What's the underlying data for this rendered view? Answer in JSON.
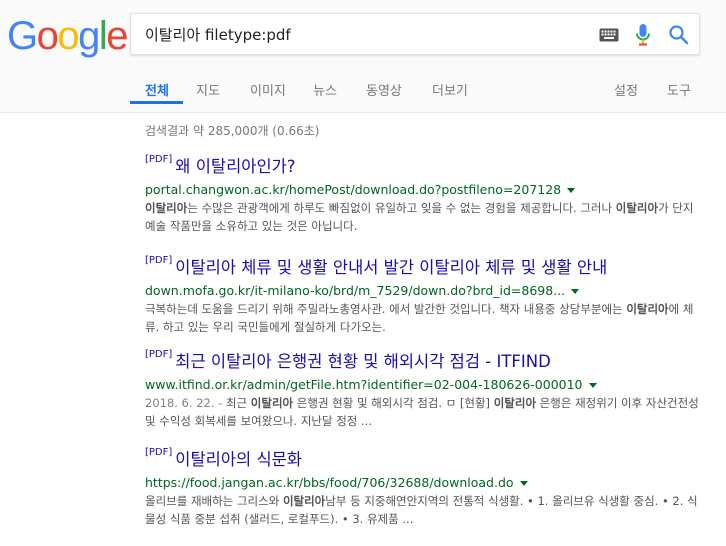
{
  "logo": {
    "text": "Google",
    "colors": [
      "#4285F4",
      "#EA4335",
      "#FBBC05",
      "#4285F4",
      "#34A853",
      "#EA4335"
    ]
  },
  "search": {
    "query": "이탈리아 filetype:pdf"
  },
  "icons": {
    "keyboard": "keyboard-icon",
    "mic": "microphone-icon",
    "search": "search-icon"
  },
  "tabs": {
    "all": "전체",
    "maps": "지도",
    "images": "이미지",
    "news": "뉴스",
    "videos": "동영상",
    "more": "더보기",
    "settings": "설정",
    "tools": "도구"
  },
  "stats": "검색결과 약 285,000개 (0.66초)",
  "results": [
    {
      "badge": "[PDF]",
      "title": "왜 이탈리아인가?",
      "url": "portal.changwon.ac.kr/homePost/download.do?postfileno=207128",
      "snippet": {
        "b1": "이탈리아",
        "t1": "는 수많은 관광객에게 하루도 빠짐없이 유일하고 잊을 수 없는 경험을 제공합니다. 그러나 ",
        "b2": "이탈리아",
        "t2": "가 단지 예술 작품만을 소유하고 있는 것은 아닙니다."
      }
    },
    {
      "badge": "[PDF]",
      "title": "이탈리아 체류 및 생활 안내서 발간 이탈리아 체류 및 생활 안내",
      "url": "down.mofa.go.kr/it-milano-ko/brd/m_7529/down.do?brd_id=8698...",
      "snippet": {
        "t1": "극복하는데 도움을 드리기 위해 주밀라노총영사관. 에서 발간한 것입니다. 책자 내용중 상당부분에는 ",
        "b1": "이탈리아",
        "t2": "에 체류. 하고 있는 우리 국민들에게 절실하게 다가오는."
      }
    },
    {
      "badge": "[PDF]",
      "title": "최근 이탈리아 은행권 현황 및 해외시각 점검 - ITFIND",
      "url": "www.itfind.or.kr/admin/getFile.htm?identifier=02-004-180626-000010",
      "snippet": {
        "date": "2018. 6. 22. - ",
        "t1": "최근 ",
        "b1": "이탈리아",
        "t2": " 은행권 현황 및 해외시각 점검. ㅁ [현황] ",
        "b2": "이탈리아",
        "t3": " 은행은 재정위기 이후 자산건전성 및 수익성 회복세를 보여왔으나. 지난달 정정 ..."
      }
    },
    {
      "badge": "[PDF]",
      "title": "이탈리아의 식문화",
      "url": "https://food.jangan.ac.kr/bbs/food/706/32688/download.do",
      "snippet": {
        "t1": "올리브를 재배하는 그리스와 ",
        "b1": "이탈리아",
        "t2": "남부 등 지중해연안지역의 전통적 식생활. • 1. 올리브유 식생활 중심. • 2. 식물성 식품 중분 섭취 (샐러드, 로컬푸드). • 3. 유제품 ..."
      }
    }
  ]
}
